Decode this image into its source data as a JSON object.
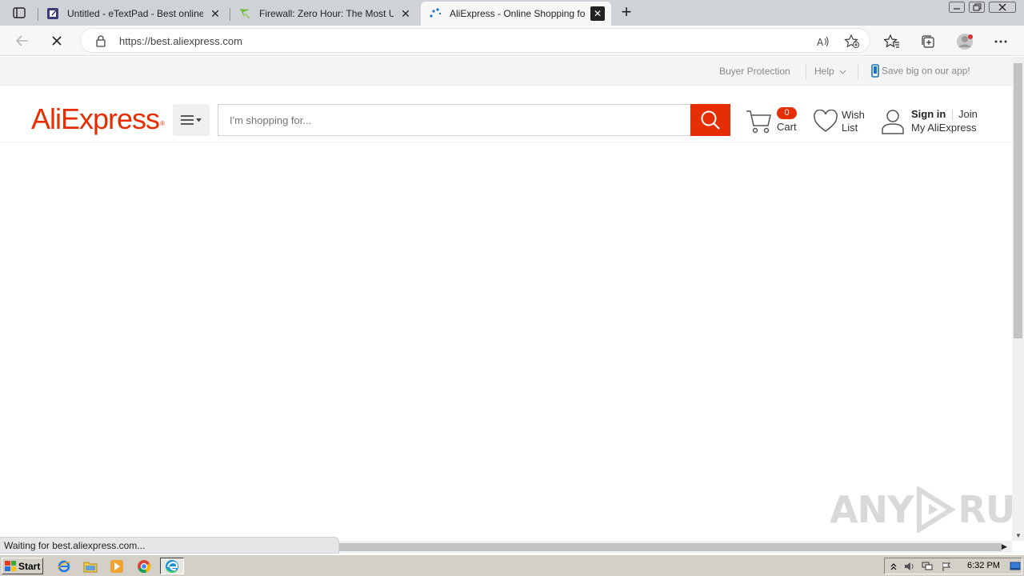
{
  "browser": {
    "tabs": [
      {
        "title": "Untitled - eTextPad - Best online Notepad",
        "active": false
      },
      {
        "title": "Firewall: Zero Hour: The Most Unique",
        "active": false
      },
      {
        "title": "AliExpress - Online Shopping for Popular",
        "active": true
      }
    ],
    "new_tab_label": "+",
    "close_glyph": "✕",
    "url": "https://best.aliexpress.com",
    "status_text": "Waiting for best.aliexpress.com..."
  },
  "page": {
    "top_links": {
      "buyer_protection": "Buyer Protection",
      "help": "Help",
      "app_promo": "Save big on our app!"
    },
    "logo_text": "AliExpress",
    "logo_mark": "®",
    "search_placeholder": "I'm shopping for...",
    "cart": {
      "count": "0",
      "label": "Cart"
    },
    "wishlist_label": "Wish List",
    "account": {
      "sign_in": "Sign in",
      "join": "Join",
      "my_account": "My AliExpress"
    }
  },
  "watermark": {
    "left": "ANY",
    "right": "RUN"
  },
  "taskbar": {
    "start_label": "Start",
    "clock": "6:32 PM"
  },
  "colors": {
    "brand": "#e62e04",
    "tabstrip": "#cfd3d7",
    "taskbar": "#d4d0c8"
  },
  "icons": [
    "tab-actions-icon",
    "etextpad-favicon",
    "firewall-favicon",
    "loading-spinner-favicon",
    "back-arrow-icon",
    "stop-loading-icon",
    "lock-icon",
    "read-aloud-icon",
    "add-favorite-icon",
    "favorites-icon",
    "collections-icon",
    "profile-avatar",
    "more-menu-icon",
    "phone-icon",
    "chevron-down-icon",
    "menu-hamburger-icon",
    "search-icon",
    "cart-icon",
    "heart-icon",
    "user-icon"
  ]
}
